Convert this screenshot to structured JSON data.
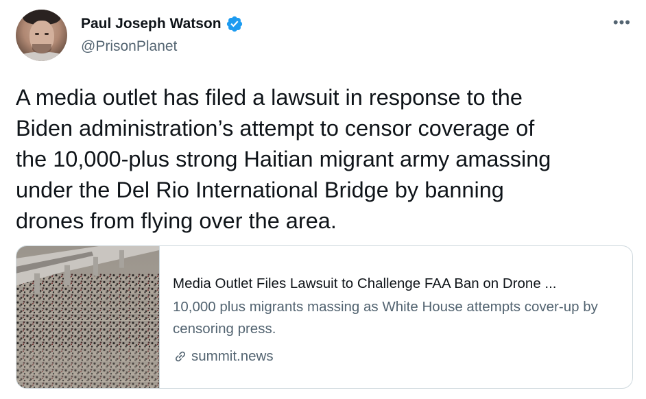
{
  "author": {
    "name": "Paul Joseph Watson",
    "handle": "@PrisonPlanet",
    "verified": true
  },
  "more_label": "•••",
  "tweet": {
    "text": "A media outlet has filed a lawsuit in response to the\nBiden administration’s attempt to censor coverage of\nthe 10,000-plus strong Haitian migrant army amassing\nunder the Del Rio International Bridge by banning\ndrones from flying over the area."
  },
  "link_card": {
    "title": "Media Outlet Files Lawsuit to Challenge FAA Ban on Drone ...",
    "description": "10,000 plus migrants massing as White House attempts cover-up by censoring press.",
    "domain": "summit.news"
  },
  "colors": {
    "text_primary": "#0f1419",
    "text_secondary": "#536471",
    "verified_blue": "#1d9bf0",
    "border": "#cfd9de"
  }
}
